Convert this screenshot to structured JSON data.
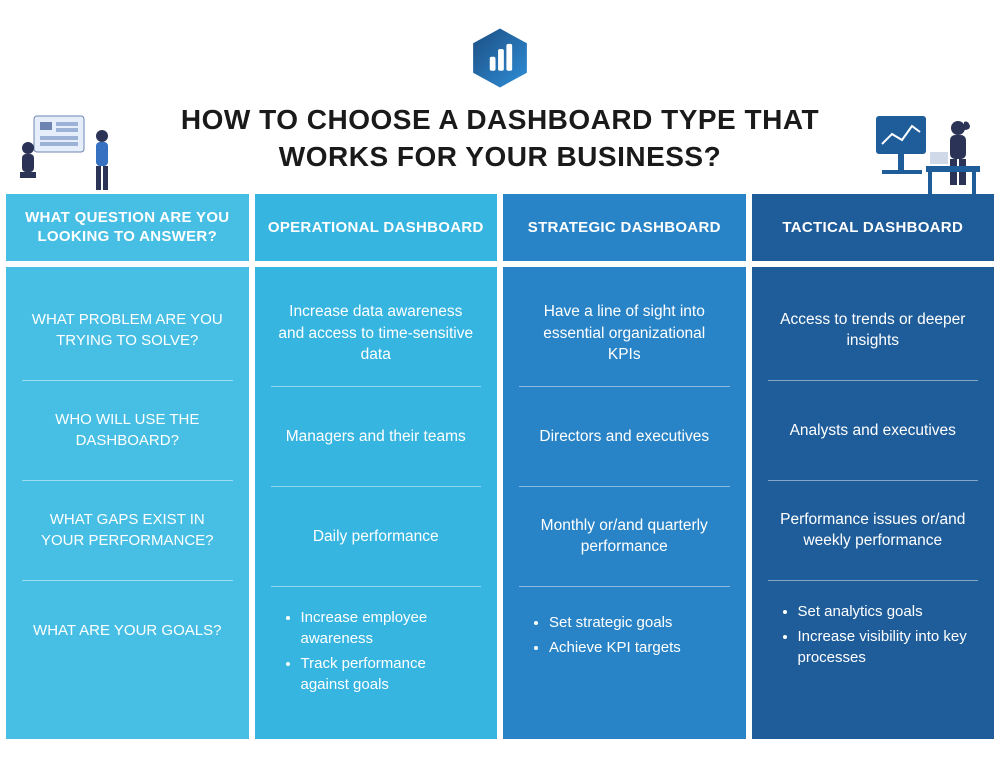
{
  "title": "HOW TO CHOOSE A DASHBOARD TYPE THAT WORKS FOR YOUR BUSINESS?",
  "columns": [
    {
      "header": "WHAT QUESTION ARE YOU LOOKING TO ANSWER?",
      "cells": [
        {
          "type": "text",
          "value": "WHAT PROBLEM ARE YOU TRYING TO SOLVE?"
        },
        {
          "type": "text",
          "value": "WHO WILL USE THE DASHBOARD?"
        },
        {
          "type": "text",
          "value": "WHAT GAPS EXIST IN YOUR PERFORMANCE?"
        },
        {
          "type": "text",
          "value": "WHAT ARE YOUR GOALS?"
        }
      ]
    },
    {
      "header": "OPERATIONAL DASHBOARD",
      "cells": [
        {
          "type": "text",
          "value": "Increase data awareness and access to time-sensitive data"
        },
        {
          "type": "text",
          "value": "Managers and their teams"
        },
        {
          "type": "text",
          "value": "Daily performance"
        },
        {
          "type": "list",
          "items": [
            "Increase employee awareness",
            "Track performance against goals"
          ]
        }
      ]
    },
    {
      "header": "STRATEGIC DASHBOARD",
      "cells": [
        {
          "type": "text",
          "value": "Have a line of sight into essential organizational KPIs"
        },
        {
          "type": "text",
          "value": "Directors and executives"
        },
        {
          "type": "text",
          "value": "Monthly or/and quarterly performance"
        },
        {
          "type": "list",
          "items": [
            "Set strategic goals",
            "Achieve KPI targets"
          ]
        }
      ]
    },
    {
      "header": "TACTICAL DASHBOARD",
      "cells": [
        {
          "type": "text",
          "value": "Access to trends or deeper insights"
        },
        {
          "type": "text",
          "value": "Analysts and executives"
        },
        {
          "type": "text",
          "value": "Performance issues or/and weekly performance"
        },
        {
          "type": "list",
          "items": [
            "Set analytics goals",
            "Increase visibility into key processes"
          ]
        }
      ]
    }
  ]
}
